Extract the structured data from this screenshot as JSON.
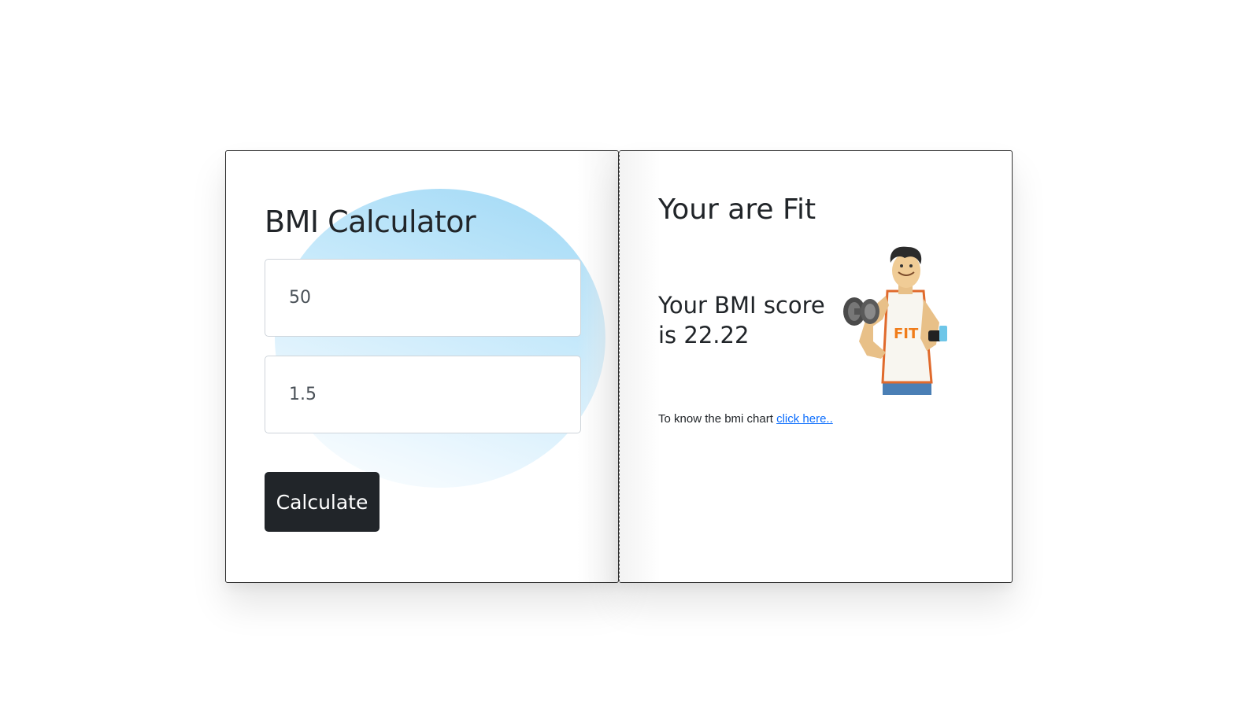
{
  "calculator": {
    "title": "BMI Calculator",
    "weight_value": "50",
    "height_value": "1.5",
    "calculate_label": "Calculate"
  },
  "result": {
    "status": "Your are Fit",
    "score_line1": "Your BMI score",
    "score_line2": "is 22.22",
    "chart_note": "To know the bmi chart",
    "chart_link": "click here..",
    "figure_badge": "FIT"
  },
  "colors": {
    "button_bg": "#212529",
    "link": "#0d6efd",
    "blob": "#9fd8f5",
    "badge": "#f07c1a"
  }
}
